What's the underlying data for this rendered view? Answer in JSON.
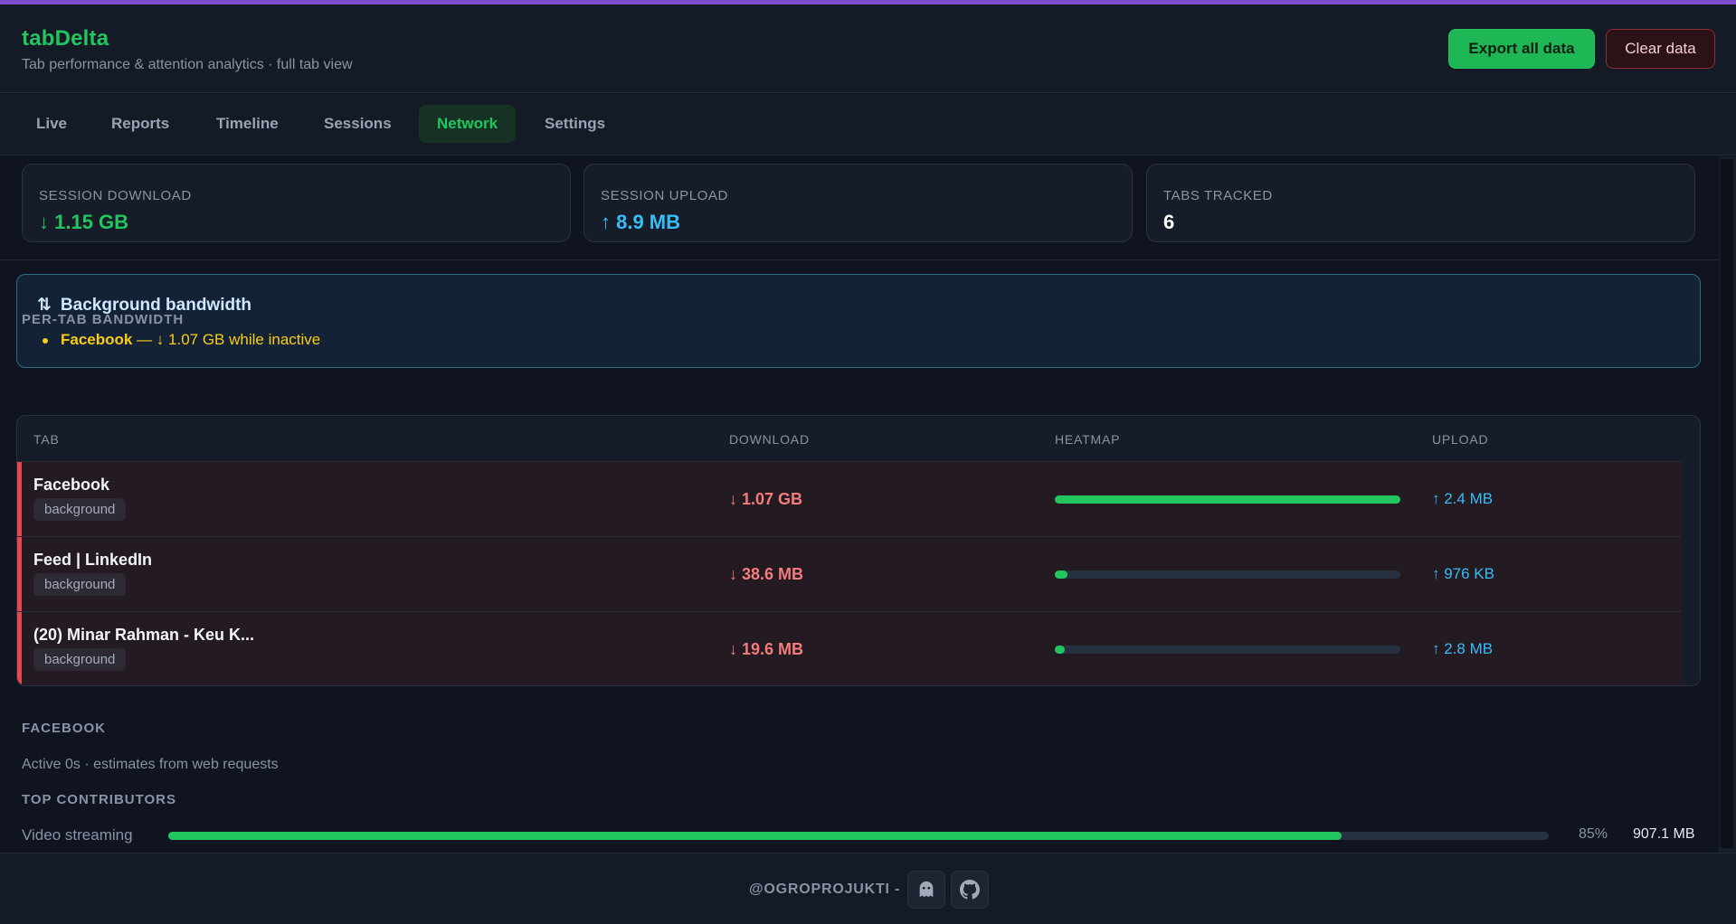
{
  "app": {
    "title": "tabDelta",
    "subtitle": "Tab performance & attention analytics · full tab view"
  },
  "header_actions": {
    "export_label": "Export all data",
    "clear_label": "Clear data"
  },
  "tabs": [
    {
      "label": "Live",
      "active": false
    },
    {
      "label": "Reports",
      "active": false
    },
    {
      "label": "Timeline",
      "active": false
    },
    {
      "label": "Sessions",
      "active": false
    },
    {
      "label": "Network",
      "active": true
    },
    {
      "label": "Settings",
      "active": false
    }
  ],
  "stats": [
    {
      "label": "SESSION DOWNLOAD",
      "value": "↓ 1.15 GB",
      "color": "#22c55e"
    },
    {
      "label": "SESSION UPLOAD",
      "value": "↑ 8.9 MB",
      "color": "#38bdf8"
    },
    {
      "label": "TABS TRACKED",
      "value": "6",
      "color": "#ffffff"
    }
  ],
  "alert": {
    "icon": "⇅",
    "icon_name": "up-down-arrows-icon",
    "title": "Background bandwidth",
    "items": [
      {
        "site": "Facebook",
        "text": " — ↓ 1.07 GB while inactive"
      }
    ]
  },
  "per_tab": {
    "section_label": "PER-TAB BANDWIDTH",
    "columns": [
      "TAB",
      "DOWNLOAD",
      "HEATMAP",
      "UPLOAD"
    ],
    "rows": [
      {
        "name": "Facebook",
        "status": "background",
        "download": "↓ 1.07 GB",
        "heat": 1.0,
        "upload": "↑ 2.4 MB"
      },
      {
        "name": "Feed | LinkedIn",
        "status": "background",
        "download": "↓ 38.6 MB",
        "heat": 0.036,
        "upload": "↑ 976 KB"
      },
      {
        "name": "(20) Minar Rahman - Keu K...",
        "status": "background",
        "download": "↓ 19.6 MB",
        "heat": 0.018,
        "upload": "↑ 2.8 MB"
      }
    ]
  },
  "detail": {
    "section_label": "FACEBOOK",
    "subtitle": "Active 0s · estimates from web requests",
    "contributors_label": "TOP CONTRIBUTORS",
    "contributors": [
      {
        "label": "Video streaming",
        "percent": 85,
        "percent_text": "85%",
        "size": "907.1 MB"
      }
    ]
  },
  "footer": {
    "text": "@OGROPROJUKTI -",
    "icons": [
      "ghost-icon",
      "github-icon"
    ]
  },
  "colors": {
    "accent": "#22c55e",
    "upload": "#38bdf8",
    "download_warn": "#f47c7c",
    "alert_text": "#facc15"
  }
}
